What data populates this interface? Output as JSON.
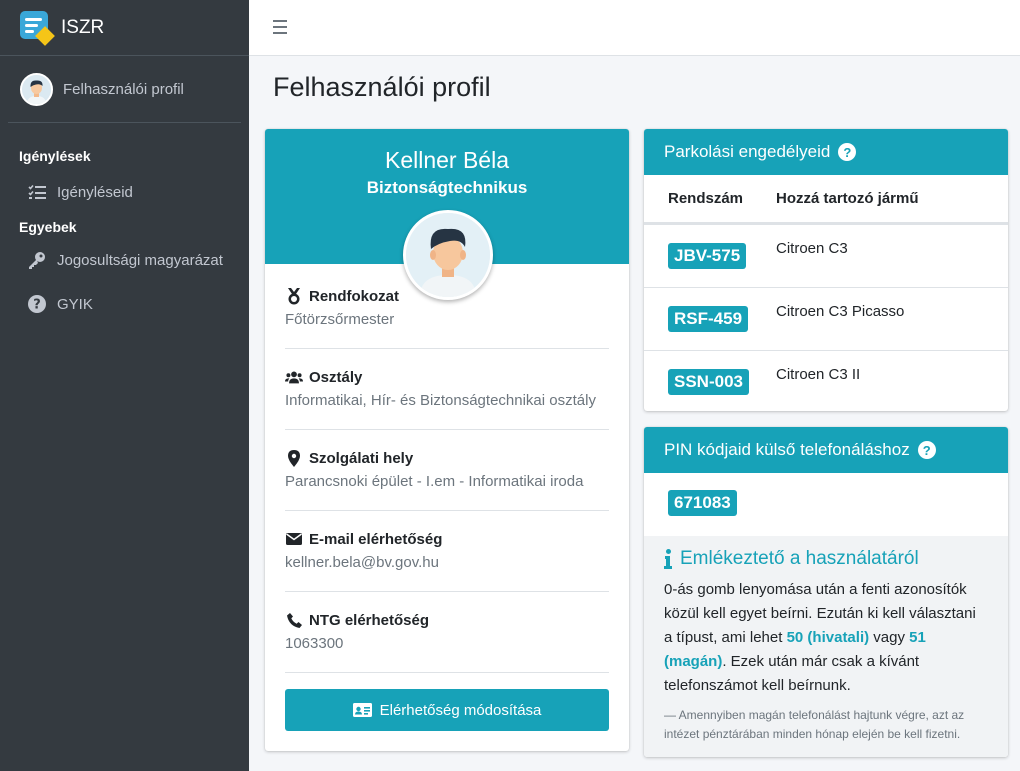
{
  "app": {
    "brand": "ISZR"
  },
  "sidebar": {
    "user_name": "Felhasználói profil",
    "sections": [
      {
        "header": "Igénylések",
        "items": [
          {
            "label": "Igényléseid",
            "icon": "tasks-icon"
          }
        ]
      },
      {
        "header": "Egyebek",
        "items": [
          {
            "label": "Jogosultsági magyarázat",
            "icon": "key-icon"
          },
          {
            "label": "GYIK",
            "icon": "question-circle-icon"
          }
        ]
      }
    ]
  },
  "page": {
    "title": "Felhasználói profil"
  },
  "profile": {
    "name": "Kellner Béla",
    "position": "Biztonságtechnikus",
    "fields": [
      {
        "label": "Rendfokozat",
        "value": "Főtörzsőrmester",
        "icon": "medal-icon"
      },
      {
        "label": "Osztály",
        "value": "Informatikai, Hír- és Biztonságtechnikai osztály",
        "icon": "users-icon"
      },
      {
        "label": "Szolgálati hely",
        "value": "Parancsnoki épület - I.em - Informatikai iroda",
        "icon": "map-marker-icon"
      },
      {
        "label": "E-mail elérhetőség",
        "value": "kellner.bela@bv.gov.hu",
        "icon": "envelope-icon"
      },
      {
        "label": "NTG elérhetőség",
        "value": "1063300",
        "icon": "phone-icon"
      }
    ],
    "edit_button": "Elérhetőség módosítása"
  },
  "parking": {
    "title": "Parkolási engedélyeid",
    "columns": [
      "Rendszám",
      "Hozzá tartozó jármű"
    ],
    "rows": [
      {
        "plate": "JBV-575",
        "vehicle": "Citroen C3"
      },
      {
        "plate": "RSF-459",
        "vehicle": "Citroen C3 Picasso"
      },
      {
        "plate": "SSN-003",
        "vehicle": "Citroen C3 II"
      }
    ]
  },
  "pin": {
    "title": "PIN kódjaid külső telefonáláshoz",
    "code": "671083",
    "note_title": "Emlékeztető a használatáról",
    "note_part1": "0-ás gomb lenyomása után a fenti azonosítók közül kell egyet beírni. Ezután ki kell választani a típust, ami lehet ",
    "note_hl1": "50 (hivatali)",
    "note_part2": " vagy ",
    "note_hl2": "51 (magán)",
    "note_part3": ". Ezek után már csak a kívánt telefonszámot kell beírnunk.",
    "note_small": "— Amennyiben magán telefonálást hajtunk végre, azt az intézet pénztárában minden hónap elején be kell fizetni."
  },
  "colors": {
    "accent": "#17a2b8",
    "sidebar": "#343a40"
  }
}
